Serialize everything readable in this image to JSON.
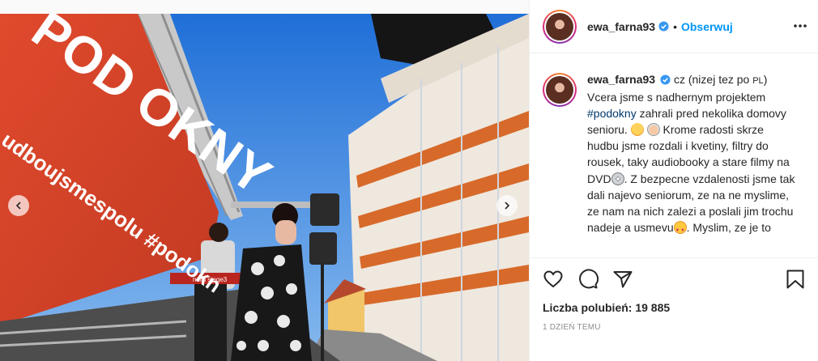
{
  "post": {
    "username": "ewa_farna93",
    "follow_label": "Obserwuj",
    "separator": "•",
    "more_icon": "more-horizontal-icon",
    "verified_icon": "verified-badge-icon"
  },
  "photo": {
    "banner_title": "POD OKNY",
    "banner_subtitle": "udboujsmespolu #podokn",
    "keyboard_label": "nord stage3",
    "prev_icon": "chevron-left-icon",
    "next_icon": "chevron-right-icon"
  },
  "caption": {
    "username": "ewa_farna93",
    "lang_note": "cz (nizej tez po",
    "lang_pl": "PL",
    "lang_close": ")",
    "line_1": "Vcera jsme s nadhernym projektem",
    "hashtag": "#podokny",
    "line_2": "zahrali pred nekolika domovy senioru.",
    "line_3": "Krome radosti skrze hudbu jsme rozdali i kvetiny, filtry do rousek, taky audiobooky a stare filmy na DVD",
    "line_4": ". Z bezpecne vzdalenosti jsme tak dali najevo seniorum, ze na ne myslime, ze nam na nich zalezi a poslali jim trochu nadeje a usmevu",
    "line_5": ". Myslim, ze je to"
  },
  "actions": {
    "like_icon": "heart-icon",
    "comment_icon": "comment-icon",
    "share_icon": "share-icon",
    "save_icon": "bookmark-icon",
    "likes_label": "Liczba polubień:",
    "likes_count": "19 885",
    "timestamp": "1 DZIEŃ TEMU"
  },
  "colors": {
    "accent_blue": "#0095f6",
    "hashtag_blue": "#00376b",
    "banner_red": "#d9462c",
    "sky_blue": "#2f7de0"
  }
}
